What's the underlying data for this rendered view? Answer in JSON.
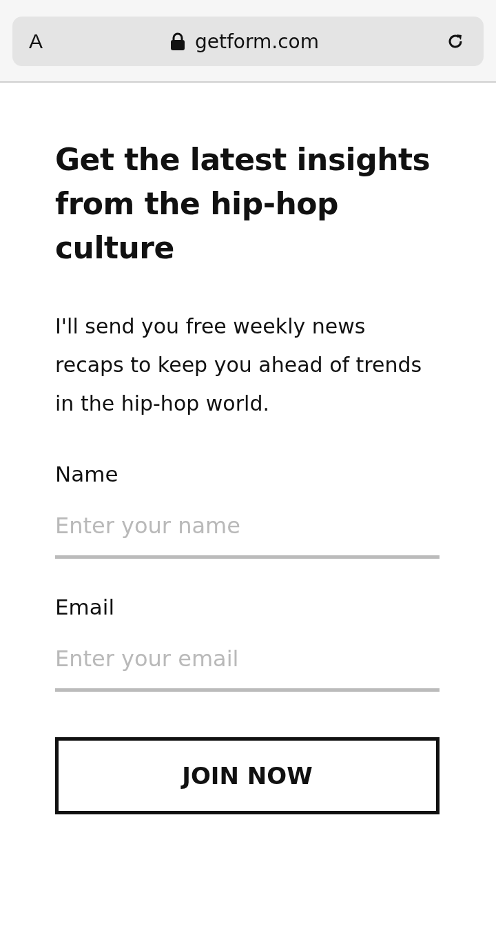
{
  "browser": {
    "reader_button": "A",
    "url": "getform.com"
  },
  "form": {
    "heading": "Get the latest insights from the hip-hop culture",
    "description": "I'll send you free weekly news recaps to keep you ahead of trends in the hip-hop world.",
    "fields": [
      {
        "label": "Name",
        "placeholder": "Enter your name"
      },
      {
        "label": "Email",
        "placeholder": "Enter your email"
      }
    ],
    "submit": "JOIN NOW"
  }
}
